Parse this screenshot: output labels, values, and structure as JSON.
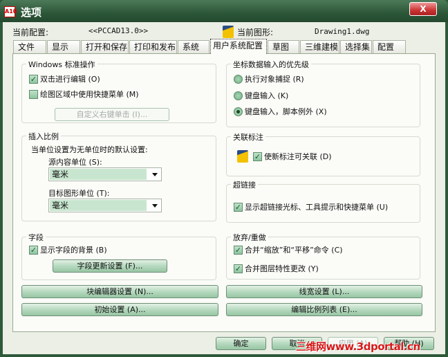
{
  "window": {
    "title": "选项",
    "close": "X",
    "app_icon": "A10"
  },
  "header": {
    "profile_label": "当前配置:",
    "profile_value": "<<PCCAD13.0>>",
    "drawing_label": "当前图形:",
    "drawing_value": "Drawing1.dwg"
  },
  "tabs": [
    "文件",
    "显示",
    "打开和保存",
    "打印和发布",
    "系统",
    "用户系统配置",
    "草图",
    "三维建模",
    "选择集",
    "配置"
  ],
  "active_tab": "用户系统配置",
  "windows_ops": {
    "title": "Windows 标准操作",
    "dblclick": "双击进行编辑 (O)",
    "dblclick_checked": true,
    "shortcut": "绘图区域中使用快捷菜单 (M)",
    "shortcut_checked": false,
    "custom_btn": "自定义右键单击 (I)..."
  },
  "insert_scale": {
    "title": "插入比例",
    "desc": "当单位设置为无单位时的默认设置:",
    "source_label": "源内容单位 (S):",
    "source_value": "毫米",
    "target_label": "目标图形单位 (T):",
    "target_value": "毫米"
  },
  "fields": {
    "title": "字段",
    "show_bg": "显示字段的背景 (B)",
    "show_bg_checked": true,
    "update_btn": "字段更新设置 (F)..."
  },
  "priority": {
    "title": "坐标数据输入的优先级",
    "options": [
      "执行对象捕捉 (R)",
      "键盘输入 (K)",
      "键盘输入，脚本例外 (X)"
    ],
    "selected": 2
  },
  "assoc": {
    "title": "关联标注",
    "label": "使新标注可关联 (D)",
    "checked": true
  },
  "hyperlink": {
    "title": "超链接",
    "label": "显示超链接光标、工具提示和快捷菜单 (U)",
    "checked": true
  },
  "undo": {
    "title": "放弃/重做",
    "combine_zoom": "合并“缩放”和“平移”命令 (C)",
    "combine_layer": "合并图层特性更改 (Y)",
    "zoom_checked": true,
    "layer_checked": true
  },
  "buttons": {
    "block_editor": "块编辑器设置 (N)...",
    "lineweight": "线宽设置 (L)...",
    "initial": "初始设置 (A)...",
    "scale_list": "编辑比例列表 (E)..."
  },
  "footer": {
    "ok": "确定",
    "cancel": "取消",
    "apply": "应用 (A)",
    "help": "帮助 (H)"
  },
  "watermark": "三维网www.3dportal.cn",
  "colors": {
    "titlebar": "#2c5638",
    "accent": "#98c6a4",
    "close": "#c33"
  }
}
